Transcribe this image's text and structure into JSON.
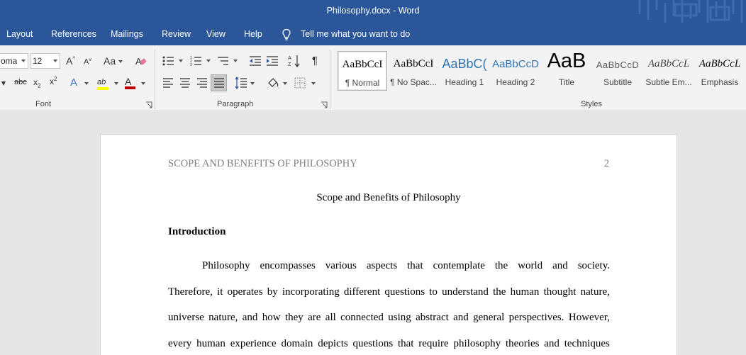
{
  "window": {
    "title": "Philosophy.docx  -  Word"
  },
  "tabs": [
    {
      "label": "Layout"
    },
    {
      "label": "References"
    },
    {
      "label": "Mailings"
    },
    {
      "label": "Review"
    },
    {
      "label": "View"
    },
    {
      "label": "Help"
    }
  ],
  "tell_me": {
    "label": "Tell me what you want to do",
    "icon": "lightbulb-icon"
  },
  "ribbon": {
    "font_group": {
      "label": "Font",
      "font_name": "Tahoma",
      "font_name_visible": "oma",
      "font_size": "12"
    },
    "paragraph_group": {
      "label": "Paragraph"
    },
    "styles_group": {
      "label": "Styles",
      "items": [
        {
          "preview": "AaBbCcI",
          "name": "¶ Normal"
        },
        {
          "preview": "AaBbCcI",
          "name": "¶ No Spac..."
        },
        {
          "preview": "AaBbC(",
          "name": "Heading 1"
        },
        {
          "preview": "AaBbCcD",
          "name": "Heading 2"
        },
        {
          "preview": "AaB",
          "name": "Title"
        },
        {
          "preview": "AaBbCcD",
          "name": "Subtitle"
        },
        {
          "preview": "AaBbCcL",
          "name": "Subtle Em..."
        },
        {
          "preview": "AaBbCcL",
          "name": "Emphasis"
        }
      ]
    }
  },
  "colors": {
    "accent": "#2b579a",
    "highlight": "#ffff00",
    "font_color": "#c00000",
    "heading_blue": "#2e74b5"
  },
  "document": {
    "running_head": "SCOPE AND BENEFITS OF PHILOSOPHY",
    "page_number": "2",
    "title": "Scope and Benefits of Philosophy",
    "heading": "Introduction",
    "lines": [
      [
        "Philosophy",
        "encompasses",
        "various",
        "aspects",
        "that",
        "contemplate",
        "the",
        "world",
        "and",
        "society."
      ],
      [
        "Therefore,",
        "it",
        "operates",
        "by",
        "incorporating",
        "different",
        "questions",
        "to",
        "understand",
        "the",
        "human",
        "thought",
        "nature,"
      ],
      [
        "universe",
        "nature,",
        "and",
        "how",
        "they",
        "are",
        "all",
        "connected",
        "using",
        "abstract",
        "and",
        "general",
        "perspectives.",
        "However,"
      ],
      [
        "every",
        "human",
        "experience",
        "domain",
        "depicts",
        "questions",
        "that",
        "require",
        "philosophy",
        "theories",
        "and",
        "techniques"
      ]
    ]
  }
}
